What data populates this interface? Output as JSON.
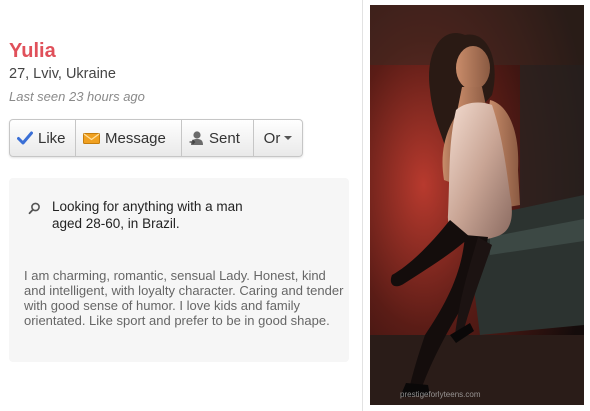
{
  "profile": {
    "name": "Yulia",
    "meta": "27, Lviv, Ukraine",
    "last_seen": "Last seen 23 hours ago"
  },
  "actions": {
    "like_label": "Like",
    "message_label": "Message",
    "sent_label": "Sent",
    "or_label": "Or"
  },
  "looking_for": {
    "line1": "Looking for anything with a man",
    "line2": "aged 28-60, in Brazil."
  },
  "about": "I am charming, romantic, sensual Lady. Honest, kind and intelligent, with loyalty character. Caring and tender with good sense of humor. I love kids and family orientated. Like sport and prefer to be in good shape.",
  "photo": {
    "watermark": "prestigeforlyteens.com"
  },
  "colors": {
    "name": "#e0505a",
    "like_icon": "#3a6fd6",
    "message_icon": "#f0a020"
  },
  "icons": {
    "like": "check-icon",
    "message": "envelope-icon",
    "sent": "user-sent-icon",
    "search": "search-icon"
  }
}
